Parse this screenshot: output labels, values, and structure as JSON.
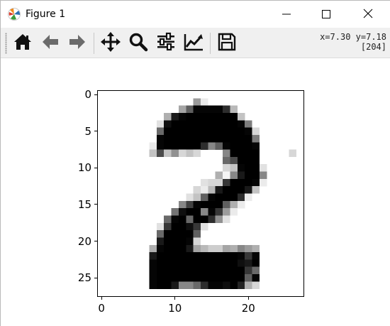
{
  "window": {
    "title": "Figure 1",
    "icons": {
      "app": "matplotlib-icon",
      "minimize": "minimize-icon",
      "maximize": "maximize-icon",
      "close": "close-icon"
    }
  },
  "toolbar": {
    "buttons": [
      {
        "icon": "home-icon",
        "name": "home-button"
      },
      {
        "icon": "back-arrow-icon",
        "name": "back-button"
      },
      {
        "icon": "forward-arrow-icon",
        "name": "forward-button"
      },
      {
        "icon": "pan-icon",
        "name": "pan-button"
      },
      {
        "icon": "zoom-icon",
        "name": "zoom-button"
      },
      {
        "icon": "subplots-config-icon",
        "name": "configure-subplots-button"
      },
      {
        "icon": "edit-axes-icon",
        "name": "edit-axes-button"
      },
      {
        "icon": "save-icon",
        "name": "save-button"
      }
    ],
    "coords": {
      "line1": "x=7.30 y=7.18",
      "line2": "[204]"
    }
  },
  "figure": {
    "xticks": [
      "0",
      "10",
      "20"
    ],
    "yticks": [
      "0",
      "5",
      "10",
      "15",
      "20",
      "25"
    ],
    "image": {
      "rows": 28,
      "cols": 28,
      "colormap": "gray_r",
      "description_value_scale": "0-255",
      "pixels": [
        [
          0,
          0,
          0,
          0,
          0,
          0,
          0,
          0,
          0,
          0,
          0,
          0,
          0,
          0,
          0,
          0,
          0,
          0,
          0,
          0,
          0,
          0,
          0,
          0,
          0,
          0,
          0,
          0
        ],
        [
          0,
          0,
          0,
          0,
          0,
          0,
          0,
          0,
          0,
          0,
          0,
          0,
          0,
          100,
          20,
          0,
          0,
          0,
          0,
          0,
          0,
          0,
          0,
          0,
          0,
          0,
          0,
          0
        ],
        [
          0,
          0,
          0,
          0,
          0,
          0,
          0,
          0,
          0,
          0,
          0,
          90,
          160,
          250,
          250,
          250,
          250,
          210,
          70,
          0,
          0,
          0,
          0,
          0,
          0,
          0,
          0,
          0
        ],
        [
          0,
          0,
          0,
          0,
          0,
          0,
          0,
          0,
          0,
          80,
          230,
          250,
          255,
          255,
          255,
          255,
          255,
          255,
          255,
          60,
          0,
          0,
          0,
          0,
          0,
          0,
          0,
          0
        ],
        [
          0,
          0,
          0,
          0,
          0,
          0,
          0,
          0,
          30,
          240,
          255,
          255,
          255,
          255,
          255,
          255,
          255,
          255,
          255,
          250,
          130,
          0,
          0,
          0,
          0,
          0,
          0,
          0
        ],
        [
          0,
          0,
          0,
          0,
          0,
          0,
          0,
          0,
          150,
          255,
          255,
          255,
          255,
          255,
          255,
          255,
          255,
          255,
          255,
          255,
          250,
          40,
          0,
          0,
          0,
          0,
          0,
          0
        ],
        [
          0,
          0,
          0,
          0,
          0,
          0,
          0,
          0,
          250,
          255,
          255,
          255,
          255,
          255,
          255,
          255,
          255,
          255,
          255,
          255,
          255,
          130,
          0,
          0,
          0,
          0,
          0,
          0
        ],
        [
          0,
          0,
          0,
          0,
          0,
          0,
          0,
          20,
          250,
          255,
          255,
          255,
          255,
          255,
          210,
          120,
          160,
          250,
          255,
          255,
          255,
          250,
          0,
          0,
          0,
          0,
          0,
          0
        ],
        [
          0,
          0,
          0,
          0,
          0,
          0,
          0,
          60,
          180,
          60,
          110,
          40,
          60,
          40,
          0,
          0,
          0,
          120,
          255,
          255,
          255,
          255,
          0,
          0,
          0,
          0,
          40,
          0
        ],
        [
          0,
          0,
          0,
          0,
          0,
          0,
          0,
          0,
          0,
          0,
          0,
          0,
          0,
          0,
          0,
          0,
          0,
          150,
          180,
          255,
          255,
          255,
          0,
          0,
          0,
          0,
          0,
          0
        ],
        [
          0,
          0,
          0,
          0,
          0,
          0,
          0,
          0,
          0,
          0,
          0,
          0,
          0,
          0,
          0,
          0,
          0,
          40,
          60,
          250,
          255,
          255,
          30,
          0,
          0,
          0,
          0,
          0
        ],
        [
          0,
          0,
          0,
          0,
          0,
          0,
          0,
          0,
          0,
          0,
          0,
          0,
          0,
          0,
          0,
          0,
          80,
          10,
          120,
          230,
          255,
          255,
          120,
          0,
          0,
          0,
          0,
          0
        ],
        [
          0,
          0,
          0,
          0,
          0,
          0,
          0,
          0,
          0,
          0,
          0,
          0,
          0,
          0,
          30,
          40,
          40,
          200,
          255,
          255,
          255,
          250,
          20,
          0,
          0,
          0,
          0,
          0
        ],
        [
          0,
          0,
          0,
          0,
          0,
          0,
          0,
          0,
          0,
          0,
          0,
          0,
          0,
          40,
          20,
          70,
          230,
          255,
          255,
          255,
          230,
          60,
          0,
          0,
          0,
          0,
          0,
          0
        ],
        [
          0,
          0,
          0,
          0,
          0,
          0,
          0,
          0,
          0,
          0,
          0,
          0,
          30,
          60,
          160,
          250,
          255,
          255,
          255,
          210,
          20,
          0,
          0,
          0,
          0,
          0,
          0,
          0
        ],
        [
          0,
          0,
          0,
          0,
          0,
          0,
          0,
          0,
          0,
          0,
          0,
          120,
          190,
          250,
          255,
          255,
          255,
          160,
          80,
          20,
          0,
          0,
          0,
          0,
          0,
          0,
          0,
          0
        ],
        [
          0,
          0,
          0,
          0,
          0,
          0,
          0,
          0,
          0,
          0,
          140,
          240,
          255,
          255,
          120,
          250,
          200,
          100,
          20,
          0,
          0,
          0,
          0,
          0,
          0,
          0,
          0,
          0
        ],
        [
          0,
          0,
          0,
          0,
          0,
          0,
          0,
          0,
          0,
          150,
          250,
          255,
          150,
          255,
          255,
          210,
          110,
          30,
          0,
          0,
          0,
          0,
          0,
          0,
          0,
          0,
          0,
          0
        ],
        [
          0,
          0,
          0,
          0,
          0,
          0,
          0,
          0,
          30,
          200,
          255,
          255,
          240,
          200,
          30,
          0,
          0,
          0,
          0,
          0,
          0,
          0,
          0,
          0,
          0,
          0,
          0,
          0
        ],
        [
          0,
          0,
          0,
          0,
          0,
          0,
          0,
          0,
          150,
          255,
          255,
          255,
          255,
          160,
          0,
          0,
          0,
          0,
          0,
          0,
          0,
          0,
          0,
          0,
          0,
          0,
          0,
          0
        ],
        [
          0,
          0,
          0,
          0,
          0,
          0,
          0,
          0,
          230,
          255,
          255,
          255,
          250,
          40,
          0,
          0,
          0,
          0,
          0,
          0,
          0,
          0,
          0,
          0,
          0,
          0,
          0,
          0
        ],
        [
          0,
          0,
          0,
          0,
          0,
          0,
          0,
          80,
          250,
          255,
          255,
          255,
          230,
          90,
          70,
          50,
          50,
          90,
          80,
          120,
          100,
          80,
          0,
          0,
          0,
          0,
          0,
          0
        ],
        [
          0,
          0,
          0,
          0,
          0,
          0,
          0,
          230,
          255,
          255,
          255,
          255,
          255,
          255,
          255,
          255,
          255,
          255,
          255,
          250,
          200,
          250,
          0,
          0,
          0,
          0,
          0,
          0
        ],
        [
          0,
          0,
          0,
          0,
          0,
          0,
          0,
          250,
          255,
          255,
          255,
          255,
          255,
          255,
          255,
          255,
          255,
          255,
          255,
          240,
          230,
          255,
          0,
          0,
          0,
          0,
          0,
          0
        ],
        [
          0,
          0,
          0,
          0,
          0,
          0,
          0,
          250,
          255,
          255,
          255,
          255,
          255,
          255,
          255,
          255,
          255,
          255,
          255,
          255,
          200,
          150,
          0,
          0,
          0,
          0,
          0,
          0
        ],
        [
          0,
          0,
          0,
          0,
          0,
          0,
          0,
          250,
          255,
          255,
          255,
          255,
          255,
          255,
          255,
          255,
          255,
          255,
          255,
          255,
          160,
          250,
          0,
          0,
          0,
          0,
          0,
          0
        ],
        [
          0,
          0,
          0,
          0,
          0,
          0,
          0,
          250,
          255,
          255,
          230,
          120,
          120,
          150,
          210,
          250,
          250,
          240,
          255,
          220,
          80,
          40,
          0,
          0,
          0,
          0,
          0,
          0
        ],
        [
          0,
          0,
          0,
          0,
          0,
          0,
          0,
          0,
          0,
          0,
          0,
          0,
          0,
          0,
          0,
          0,
          0,
          0,
          0,
          0,
          0,
          0,
          0,
          0,
          0,
          0,
          0,
          0
        ]
      ]
    }
  }
}
